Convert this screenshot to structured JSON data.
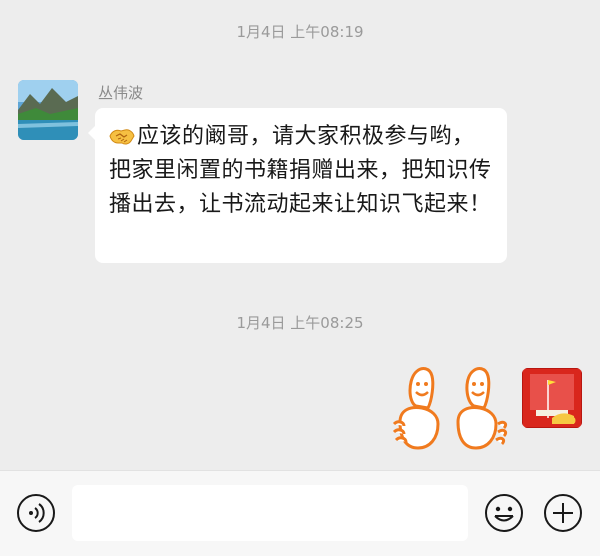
{
  "timestamps": [
    "1月4日 上午08:19",
    "1月4日 上午08:25"
  ],
  "messages": [
    {
      "sender": "丛伟波",
      "side": "left",
      "emoji": "handshake-icon",
      "text": "应该的阚哥，请大家积极参与哟，把家里闲置的书籍捐赠出来，把知识传播出去，让书流动起来让知识飞起来！"
    },
    {
      "side": "right",
      "sticker": "thumbs-up-sticker"
    }
  ],
  "input": {
    "value": "",
    "placeholder": ""
  },
  "colors": {
    "background": "#ededed",
    "bubble": "#ffffff",
    "timestamp": "#9a9a9a",
    "sticker_stroke": "#f07a1e"
  }
}
